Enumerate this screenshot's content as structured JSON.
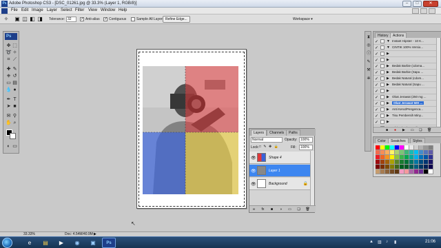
{
  "window": {
    "title": "Adobe Photoshop CS3 - [DSC_01261.jpg @ 33.3% (Layer 1, RGB/8)]",
    "app_icon_label": "Ps",
    "minimize": "‒",
    "maximize": "□",
    "close": "✕"
  },
  "menu": {
    "items": [
      "File",
      "Edit",
      "Image",
      "Layer",
      "Select",
      "Filter",
      "View",
      "Window",
      "Help"
    ]
  },
  "options": {
    "tolerance_label": "Tolerance:",
    "tolerance_value": "32",
    "antialias_label": "Anti-alias",
    "contiguous_label": "Contiguous",
    "sample_all_label": "Sample All Layers",
    "refine_edge": "Refine Edge...",
    "workspace": "Workspace ▾"
  },
  "tools": {
    "badge": "Ps"
  },
  "layers_panel": {
    "tabs": [
      "Layers",
      "Channels",
      "Paths"
    ],
    "blend_mode": "Normal",
    "opacity_label": "Opacity:",
    "opacity_value": "100%",
    "lock_label": "Lock:",
    "fill_label": "Fill:",
    "fill_value": "100%",
    "layers": [
      {
        "name": "Shape 4",
        "selected": false
      },
      {
        "name": "Layer 1",
        "selected": true
      },
      {
        "name": "Background",
        "selected": false
      }
    ]
  },
  "actions_panel": {
    "tabs": [
      "History",
      "Actions"
    ],
    "rows": [
      {
        "text": "Instant Hipster - 10 K...",
        "checked": true,
        "expanded": true,
        "highlight": false
      },
      {
        "text": "CINTIK 100% Versio...",
        "checked": true,
        "expanded": true,
        "highlight": false
      },
      {
        "text": "",
        "checked": true,
        "expanded": false,
        "highlight": false
      },
      {
        "text": "",
        "checked": true,
        "expanded": false,
        "highlight": false
      },
      {
        "text": "Bedak Barbie (cdoma...",
        "checked": true,
        "expanded": false,
        "highlight": false
      },
      {
        "text": "Bedak Barbie (Sapu ...",
        "checked": true,
        "expanded": false,
        "highlight": false
      },
      {
        "text": "Bedak Natural (cdom...",
        "checked": true,
        "expanded": false,
        "highlight": false
      },
      {
        "text": "Bedak Natural (Sapu ...",
        "checked": true,
        "expanded": false,
        "highlight": false
      },
      {
        "text": "",
        "checked": true,
        "expanded": false,
        "highlight": false
      },
      {
        "text": "Obat Jerawat (250 mg ...",
        "checked": true,
        "expanded": false,
        "highlight": false
      },
      {
        "text": "Obat Jerawat 500 ...",
        "checked": true,
        "expanded": false,
        "highlight": true
      },
      {
        "text": "Anti Kerut/Pengenca...",
        "checked": true,
        "expanded": false,
        "highlight": false
      },
      {
        "text": "Tisu Pembersih Miny...",
        "checked": true,
        "expanded": false,
        "highlight": false
      },
      {
        "text": "",
        "checked": true,
        "expanded": false,
        "highlight": false
      },
      {
        "text": "Whitening(Pemutih K...",
        "checked": true,
        "expanded": false,
        "highlight": false
      }
    ]
  },
  "swatches_panel": {
    "tabs": [
      "Color",
      "Swatches",
      "Styles"
    ]
  },
  "status": {
    "zoom": "33.33%",
    "doc": "Doc: 4.54M/40.9M"
  },
  "taskbar": {
    "clock": "21:06"
  },
  "colors": {
    "quad_red": "#e0383a",
    "quad_blue": "#3a63d8",
    "quad_yellow": "#f2d23a",
    "selection_blue": "#3d86f0"
  }
}
